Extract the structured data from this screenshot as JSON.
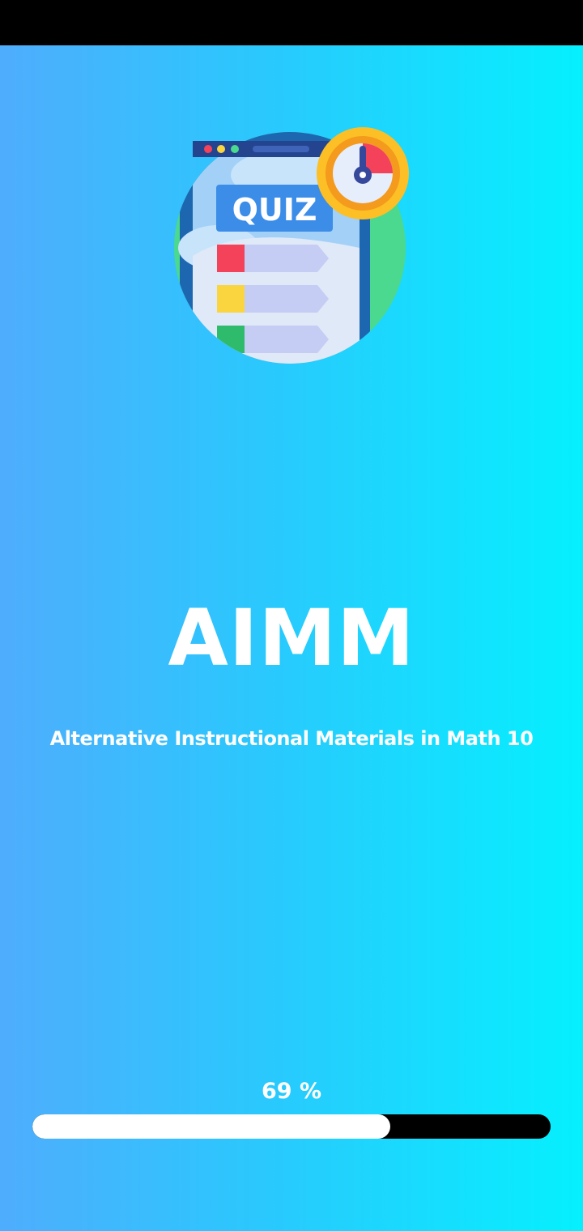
{
  "app": {
    "title": "AIMM",
    "subtitle": "Alternative Instructional Materials in Math 10"
  },
  "logo": {
    "icon": "quiz-stopwatch-icon",
    "text": "QUIZ"
  },
  "loading": {
    "percent_label": "69 %",
    "progress": 0.69
  },
  "colors": {
    "gradient_start": "#4fadfd",
    "gradient_end": "#05f0fe",
    "progress_fill": "#ffffff",
    "progress_track": "#000000"
  }
}
